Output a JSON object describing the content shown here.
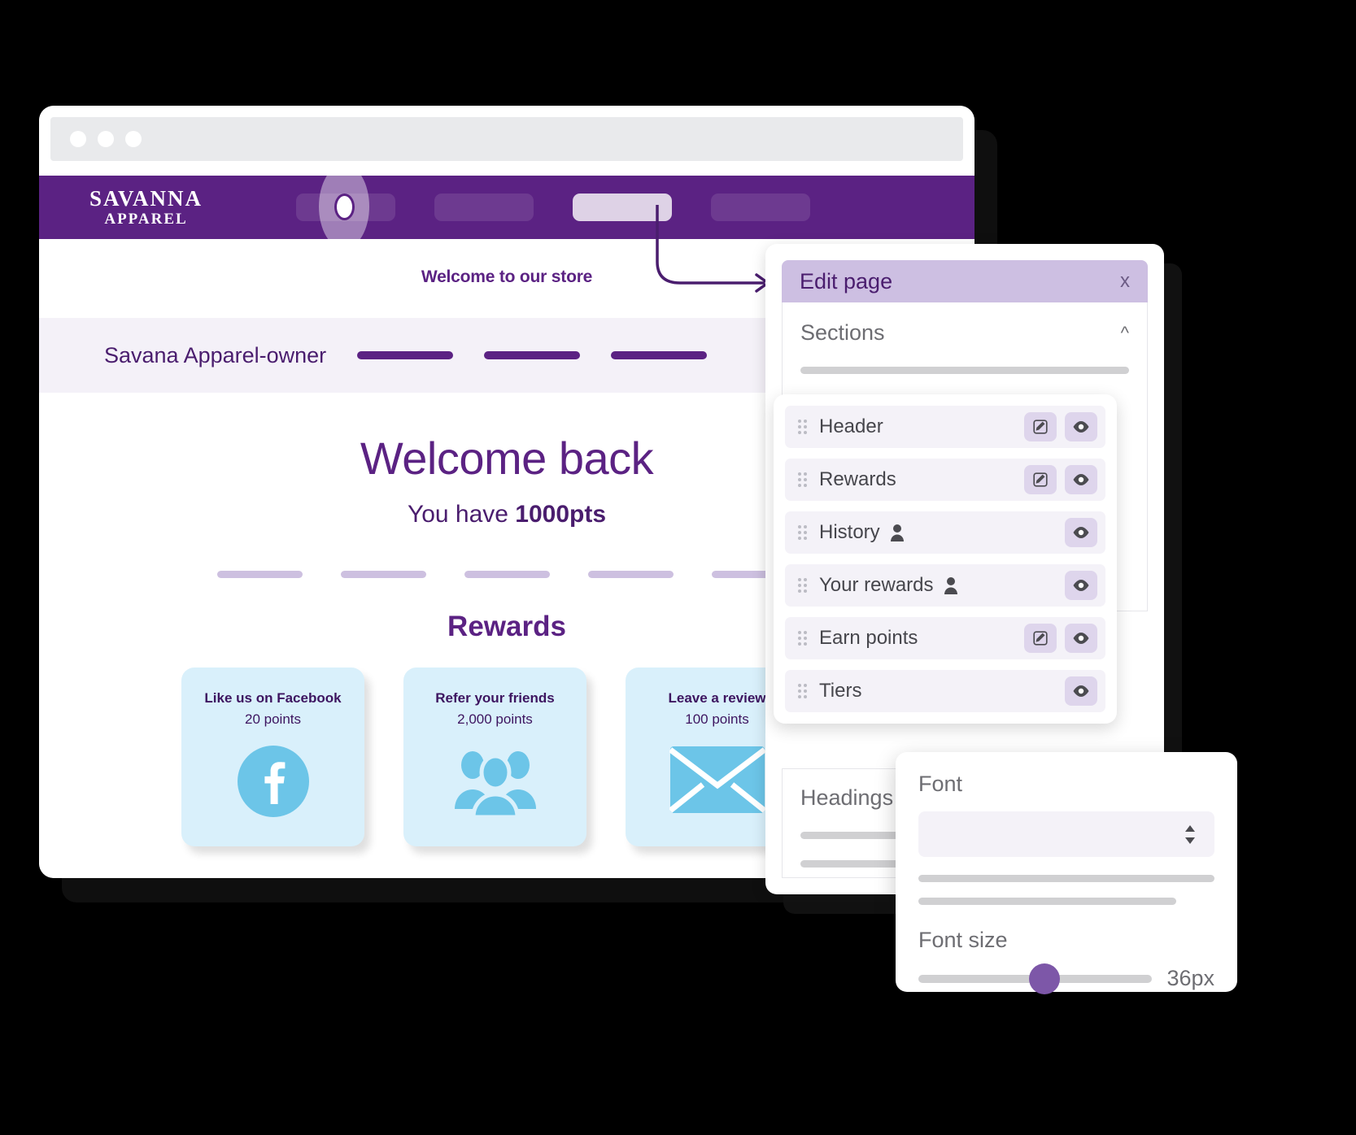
{
  "browser": {
    "titlebar": {
      "dots": [
        "dot-red",
        "dot-yellow",
        "dot-green"
      ]
    },
    "store": {
      "brand_top": "SAVANNA",
      "brand_bottom": "APPAREL",
      "nav_items": [
        "nav-item-1",
        "nav-item-2",
        "nav-item-3",
        "nav-item-4"
      ],
      "welcome_line": "Welcome to our store",
      "subbar_title": "Savana Apparel-owner",
      "hero_title": "Welcome back",
      "points_prefix": "You have ",
      "points_value": "1000pts",
      "rewards_heading": "Rewards",
      "cards": [
        {
          "title": "Like us on Facebook",
          "points": "20 points",
          "icon": "facebook-icon"
        },
        {
          "title": "Refer your friends",
          "points": "2,000 points",
          "icon": "people-group-icon"
        },
        {
          "title": "Leave a review",
          "points": "100 points",
          "icon": "envelope-icon"
        }
      ]
    }
  },
  "edit_panel": {
    "title": "Edit page",
    "close_label": "x",
    "sections_title": "Sections",
    "collapse_icon": "^",
    "sections": [
      {
        "label": "Header",
        "has_edit": true,
        "has_person": false,
        "has_eye": true
      },
      {
        "label": "Rewards",
        "has_edit": true,
        "has_person": false,
        "has_eye": true
      },
      {
        "label": "History",
        "has_edit": false,
        "has_person": true,
        "has_eye": true
      },
      {
        "label": "Your rewards",
        "has_edit": false,
        "has_person": true,
        "has_eye": true
      },
      {
        "label": "Earn points",
        "has_edit": true,
        "has_person": false,
        "has_eye": true
      },
      {
        "label": "Tiers",
        "has_edit": false,
        "has_person": false,
        "has_eye": true
      }
    ],
    "headings_title": "Headings"
  },
  "font_panel": {
    "title": "Font",
    "font_value": "",
    "font_size_label": "Font size",
    "font_size_value": "36px"
  },
  "colors": {
    "brand_purple": "#5b2283",
    "deep_purple": "#4a1d6e",
    "lilac": "#cdbfe2",
    "light_lilac": "#ded5ec",
    "card_blue": "#d9f0fb",
    "icon_blue": "#6cc5e8",
    "slider_purple": "#7d57a8",
    "panel_gray": "#f4f2f8"
  }
}
